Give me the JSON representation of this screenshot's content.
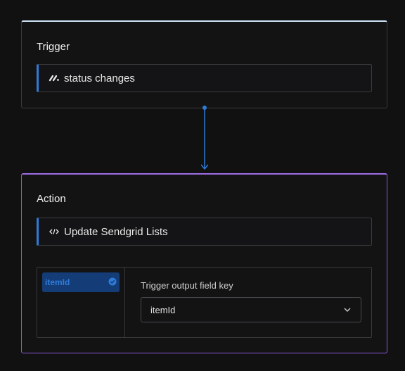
{
  "trigger": {
    "title": "Trigger",
    "event_label": "status changes",
    "event_icon": "monday-logo-icon"
  },
  "action": {
    "title": "Action",
    "action_label": "Update Sendgrid Lists",
    "action_icon": "code-icon",
    "mapping": {
      "selected_field": "itemId",
      "field_key_label": "Trigger output field key",
      "field_key_value": "itemId"
    }
  },
  "colors": {
    "accent_blue": "#2f7bd8",
    "action_border": "#8a5ad6",
    "chip_bg": "#143d78"
  }
}
